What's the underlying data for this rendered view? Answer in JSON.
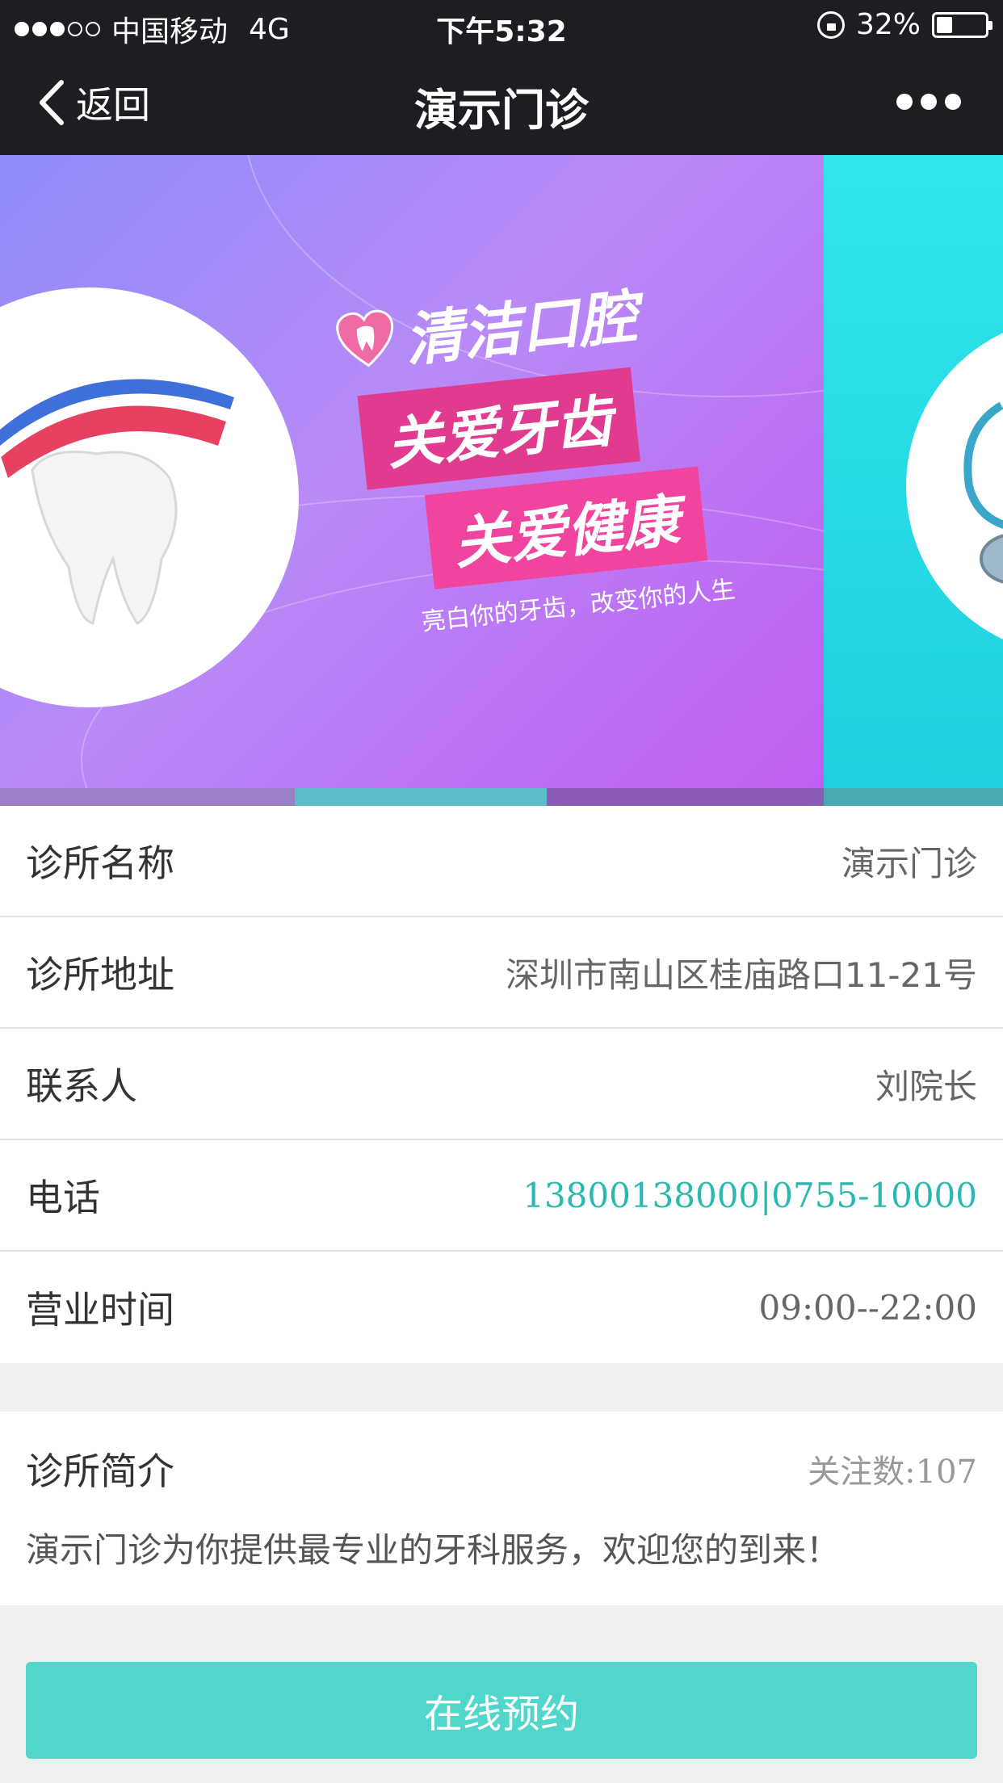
{
  "status_bar": {
    "carrier": "中国移动",
    "network": "4G",
    "time": "下午5:32",
    "battery": "32%",
    "battery_level": 0.32
  },
  "nav": {
    "back_label": "返回",
    "title": "演示门诊"
  },
  "banner": {
    "headline": "清洁口腔",
    "line1": "关爱牙齿",
    "line2": "关爱健康",
    "subline": "亮白你的牙齿，改变你的人生",
    "active_index": 1,
    "indicator_count": 4
  },
  "info": {
    "rows": [
      {
        "label": "诊所名称",
        "value": "演示门诊"
      },
      {
        "label": "诊所地址",
        "value": "深圳市南山区桂庙路口11-21号"
      },
      {
        "label": "联系人",
        "value": "刘院长"
      },
      {
        "label": "电话",
        "value": "13800138000|0755-10000"
      },
      {
        "label": "营业时间",
        "value": "09:00--22:00"
      }
    ]
  },
  "intro": {
    "label": "诊所简介",
    "follow_count": "关注数:107",
    "text": "演示门诊为你提供最专业的牙科服务，欢迎您的到来！"
  },
  "action": {
    "book_label": "在线预约"
  },
  "colors": {
    "accent": "#50d6cb",
    "phone": "#2bb8b0",
    "navbar": "#1d1d22"
  }
}
